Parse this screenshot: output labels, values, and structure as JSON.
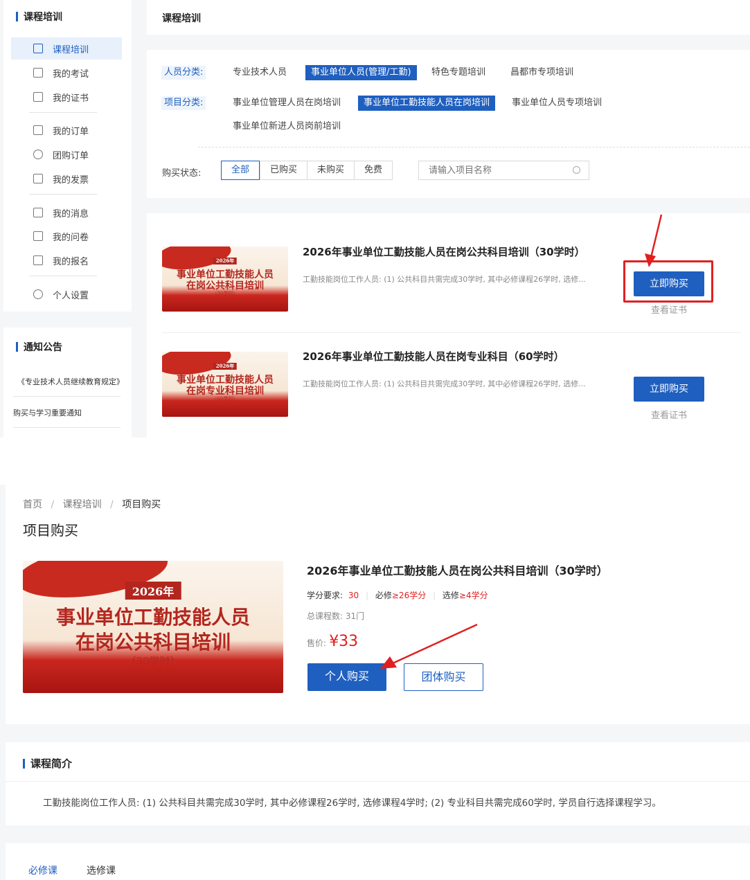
{
  "colors": {
    "accent": "#1f5fbf",
    "annotation": "#e02020",
    "price": "#e02020"
  },
  "top": {
    "sidebar": {
      "heading": "课程培训",
      "items": [
        {
          "label": "课程培训",
          "icon": "book-icon"
        },
        {
          "label": "我的考试",
          "icon": "exam-icon"
        },
        {
          "label": "我的证书",
          "icon": "certificate-icon"
        },
        {
          "label": "我的订单",
          "icon": "order-icon"
        },
        {
          "label": "团购订单",
          "icon": "group-icon"
        },
        {
          "label": "我的发票",
          "icon": "invoice-icon"
        },
        {
          "label": "我的消息",
          "icon": "message-icon"
        },
        {
          "label": "我的问卷",
          "icon": "survey-icon"
        },
        {
          "label": "我的报名",
          "icon": "signup-icon"
        },
        {
          "label": "个人设置",
          "icon": "settings-icon"
        }
      ],
      "notice_heading": "通知公告",
      "notices": [
        "《专业技术人员继续教育规定》",
        "购买与学习重要通知"
      ]
    },
    "page_title": "课程培训",
    "filters": {
      "person_label": "人员分类:",
      "person_options": [
        "专业技术人员",
        "事业单位人员(管理/工勤)",
        "特色专题培训",
        "昌都市专项培训"
      ],
      "project_label": "项目分类:",
      "project_options": [
        "事业单位管理人员在岗培训",
        "事业单位工勤技能人员在岗培训",
        "事业单位人员专项培训",
        "事业单位新进人员岗前培训"
      ],
      "status_label": "购买状态:",
      "status_options": [
        "全部",
        "已购买",
        "未购买",
        "免费"
      ],
      "search_placeholder": "请输入项目名称"
    },
    "courses": [
      {
        "title": "2026年事业单位工勤技能人员在岗公共科目培训（30学时）",
        "desc": "工勤技能岗位工作人员: (1) 公共科目共需完成30学时, 其中必修课程26学时, 选修...",
        "buy": "立即购买",
        "cert": "查看证书",
        "banner_year": "2026年",
        "banner_l1": "事业单位工勤技能人员",
        "banner_l2": "在岗公共科目培训",
        "banner_hours": "（30学时）"
      },
      {
        "title": "2026年事业单位工勤技能人员在岗专业科目（60学时）",
        "desc": "工勤技能岗位工作人员: (1) 公共科目共需完成30学时, 其中必修课程26学时, 选修...",
        "buy": "立即购买",
        "cert": "查看证书",
        "banner_year": "2026年",
        "banner_l1": "事业单位工勤技能人员",
        "banner_l2": "在岗专业科目培训",
        "banner_hours": "（60学时）"
      }
    ]
  },
  "bottom": {
    "breadcrumb": [
      "首页",
      "课程培训",
      "项目购买"
    ],
    "page_title": "项目购买",
    "product": {
      "title": "2026年事业单位工勤技能人员在岗公共科目培训（30学时）",
      "credit_label": "学分要求:",
      "credit_value": "30",
      "required_label": "必修",
      "required_value": "≥26学分",
      "elective_label": "选修",
      "elective_value": "≥4学分",
      "course_count": "总课程数: 31门",
      "price_label": "售价:",
      "price": "¥33",
      "buy_personal": "个人购买",
      "buy_group": "团体购买",
      "banner_year": "2026年",
      "banner_l1": "事业单位工勤技能人员",
      "banner_l2": "在岗公共科目培训",
      "banner_hours": "（30学时）"
    },
    "intro_heading": "课程简介",
    "intro_text": "工勤技能岗位工作人员: (1) 公共科目共需完成30学时, 其中必修课程26学时, 选修课程4学时; (2) 专业科目共需完成60学时, 学员自行选择课程学习。",
    "tabs": [
      "必修课",
      "选修课"
    ]
  }
}
